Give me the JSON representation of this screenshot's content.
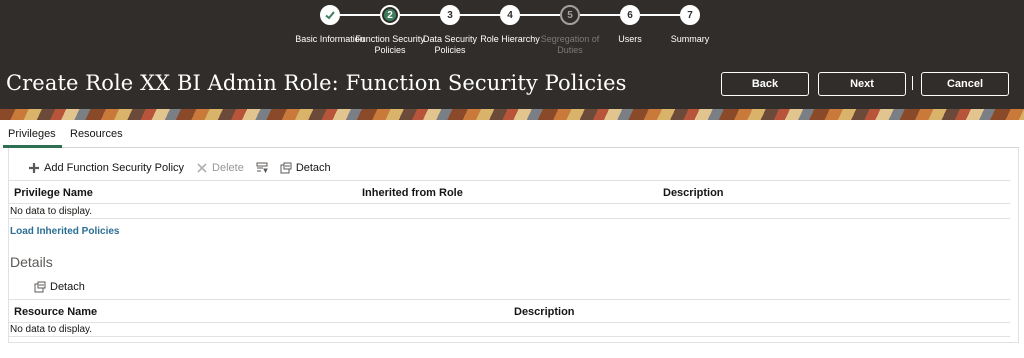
{
  "train": {
    "stops": [
      {
        "number": "",
        "label": "Basic Information",
        "state": "done"
      },
      {
        "number": "2",
        "label": "Function Security Policies",
        "state": "current"
      },
      {
        "number": "3",
        "label": "Data Security Policies",
        "state": "todo"
      },
      {
        "number": "4",
        "label": "Role Hierarchy",
        "state": "todo"
      },
      {
        "number": "5",
        "label": "Segregation of Duties",
        "state": "disabled"
      },
      {
        "number": "6",
        "label": "Users",
        "state": "todo"
      },
      {
        "number": "7",
        "label": "Summary",
        "state": "todo"
      }
    ]
  },
  "header": {
    "title": "Create Role XX BI Admin Role: Function Security Policies",
    "back_label": "Back",
    "next_label": "Next",
    "cancel_label": "Cancel"
  },
  "tabs": {
    "privileges": "Privileges",
    "resources": "Resources"
  },
  "toolbar": {
    "add_label": "Add Function Security Policy",
    "delete_label": "Delete",
    "detach_label": "Detach"
  },
  "privileges_table": {
    "columns": [
      "Privilege Name",
      "Inherited from Role",
      "Description"
    ],
    "empty_text": "No data to display."
  },
  "load_link": "Load Inherited Policies",
  "details": {
    "title": "Details",
    "detach_label": "Detach",
    "columns": [
      "Resource Name",
      "Description"
    ],
    "empty_text": "No data to display."
  },
  "colors": {
    "header_bg": "#312d2a",
    "current_step": "#3d7d5c",
    "link": "#2b6e94"
  }
}
